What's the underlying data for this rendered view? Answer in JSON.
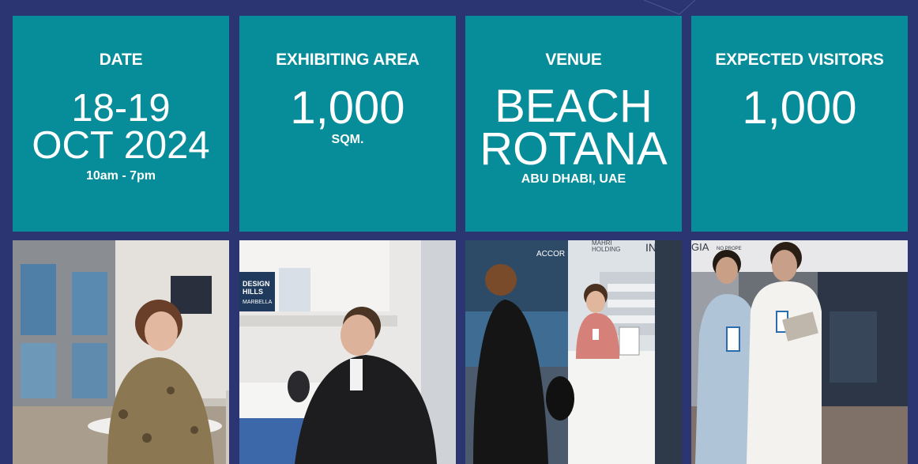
{
  "stats": [
    {
      "label": "DATE",
      "value_lines": [
        "18-19",
        "OCT 2024"
      ],
      "sub": "10am - 7pm"
    },
    {
      "label": "EXHIBITING AREA",
      "value_lines": [
        "1,000"
      ],
      "sub": "SQM."
    },
    {
      "label": "VENUE",
      "value_lines": [
        "BEACH",
        "ROTANA"
      ],
      "sub": "ABU DHABI, UAE"
    },
    {
      "label": "EXPECTED VISITORS",
      "value_lines": [
        "1,000"
      ],
      "sub": ""
    }
  ],
  "photos": {
    "photo2_book_text_1": "DESIGN",
    "photo2_book_text_2": "HILLS",
    "photo2_book_text_3": "MARBELLA",
    "photo3_banner_1": "MAHRI",
    "photo3_banner_2": "HOLDING",
    "photo3_banner_3": "IN GEO",
    "photo3_banner_4": "ACCOR",
    "photo4_banner_1": "GIA",
    "photo4_banner_2": "NO PROPE"
  },
  "colors": {
    "background": "#2b3572",
    "tile": "#078c9a",
    "text": "#ffffff"
  }
}
